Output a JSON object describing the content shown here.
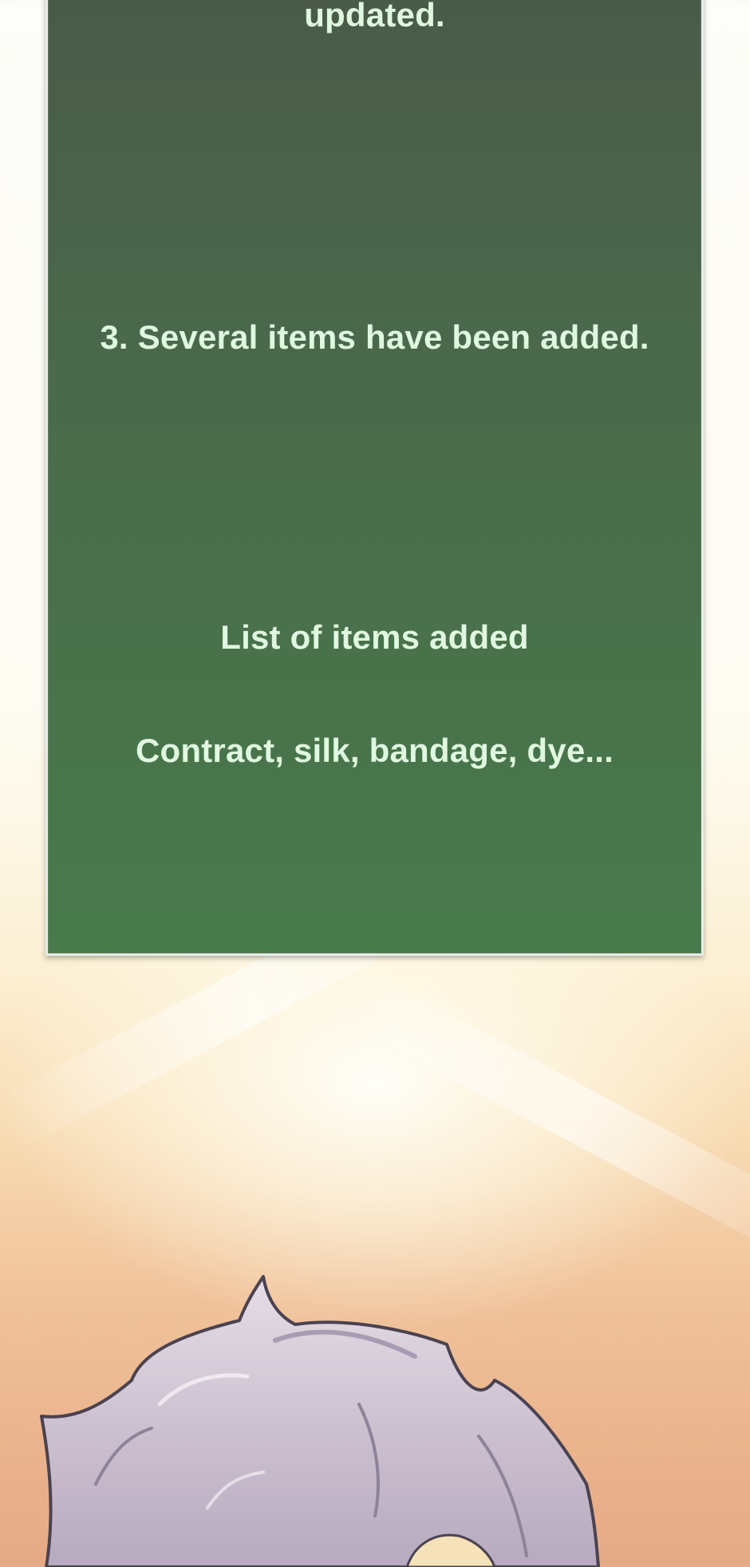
{
  "panel": {
    "line1": "updated.",
    "line2": "3. Several items have been added.",
    "line3": "List of items added",
    "line4": "Contract, silk, bandage, dye..."
  },
  "colors": {
    "panel_top": "#4a5a4a",
    "panel_bottom": "#487a4b",
    "panel_text": "#dff8df",
    "panel_border": "#e9ece6",
    "hair": "#cfc4d3",
    "hair_outline": "#4a4250",
    "background_warm": "#e6aa86"
  },
  "icons": {
    "character": "character-hair-illustration"
  }
}
